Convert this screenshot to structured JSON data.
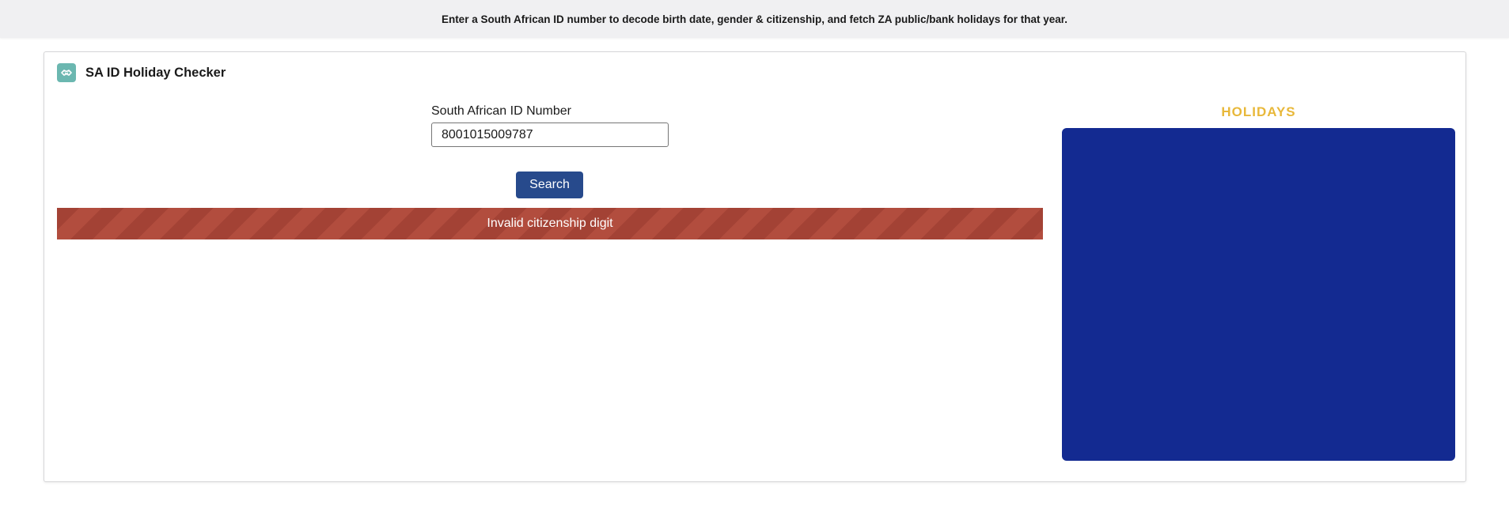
{
  "banner": {
    "text": "Enter a South African ID number to decode birth date, gender & citizenship, and fetch ZA public/bank holidays for that year."
  },
  "app": {
    "title": "SA ID Holiday Checker",
    "icon": "handshake-icon"
  },
  "form": {
    "label": "South African ID Number",
    "id_value": "8001015009787",
    "search_label": "Search"
  },
  "error": {
    "message": "Invalid citizenship digit"
  },
  "holidays": {
    "title": "HOLIDAYS"
  },
  "colors": {
    "banner_bg": "#f0f0f2",
    "button": "#274a8c",
    "error": "#ad4a3b",
    "holidays_title": "#e8b83a",
    "holidays_panel": "#132a91",
    "app_icon": "#6bb7b0"
  }
}
